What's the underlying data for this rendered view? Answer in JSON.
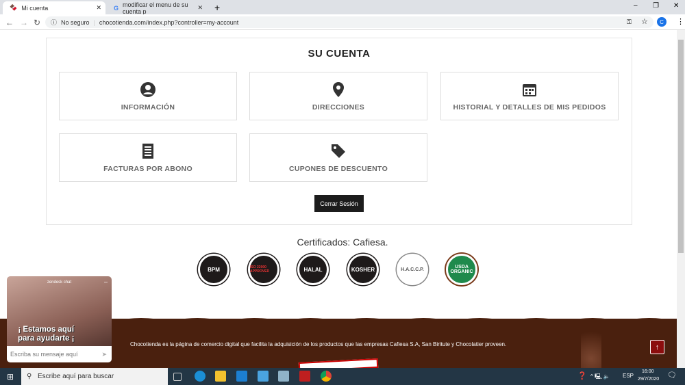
{
  "browser": {
    "tabs": [
      {
        "title": "Mi cuenta"
      },
      {
        "title": "modificar el menu de su cuenta p"
      }
    ],
    "security": "No seguro",
    "url": "chocotienda.com/index.php?controller=my-account",
    "profile_initial": "C"
  },
  "account": {
    "title": "SU CUENTA",
    "tiles": [
      {
        "label": "INFORMACIÓN",
        "icon": "user-circle-icon"
      },
      {
        "label": "DIRECCIONES",
        "icon": "map-pin-icon"
      },
      {
        "label": "HISTORIAL Y DETALLES DE MIS PEDIDOS",
        "icon": "calendar-icon"
      },
      {
        "label": "FACTURAS POR ABONO",
        "icon": "receipt-icon"
      },
      {
        "label": "CUPONES DE DESCUENTO",
        "icon": "tag-icon"
      }
    ],
    "logout": "Cerrar Sesión"
  },
  "certs": {
    "title": "Certificados: Cafiesa.",
    "logos": [
      "BPM",
      "ISO 22000 APPROVED",
      "HALAL",
      "KOSHER",
      "H.A.C.C.P.",
      "USDA ORGANIC"
    ]
  },
  "footer": {
    "text": "Chocotienda es la página de comercio digital que facilita la adquisición de los productos que las empresas Cafiesa S.A, San Biritute y Chocolatier proveen."
  },
  "chat": {
    "header": "zendesk chat",
    "banner_line1": "¡ Estamos aquí",
    "banner_line2": "para ayudarte ¡",
    "placeholder": "Escriba su mensaje aquí"
  },
  "taskbar": {
    "search": "Escribe aquí para buscar",
    "lang": "ESP",
    "time": "16:00",
    "date": "29/7/2020"
  }
}
